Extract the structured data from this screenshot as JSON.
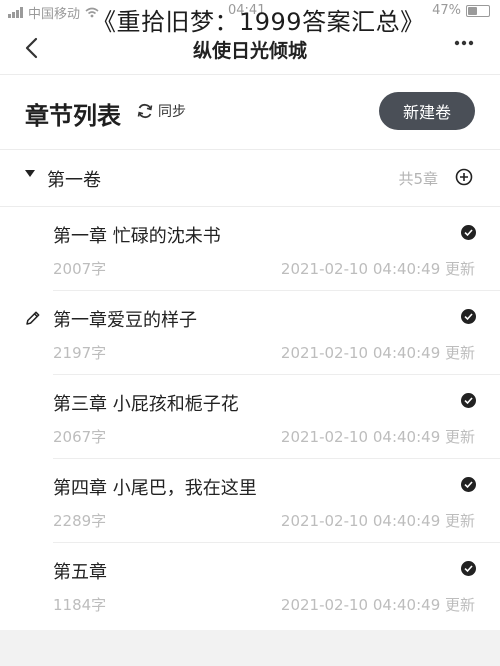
{
  "status_bar": {
    "carrier": "中国移动",
    "time": "04:41",
    "battery": "47%",
    "battery_level": 0.47
  },
  "watermark": "《重拾旧梦：1999答案汇总》",
  "nav": {
    "title": "纵使日光倾城",
    "back_icon": "chevron-left-icon",
    "more_icon": "more-dots-icon"
  },
  "header": {
    "title": "章节列表",
    "sync_label": "同步",
    "new_volume_button": "新建卷"
  },
  "volume": {
    "name": "第一卷",
    "count": "共5章",
    "add_icon": "add-circle-icon"
  },
  "chapters": [
    {
      "title": "第一章  忙碌的沈未书",
      "words": "2007字",
      "updated": "2021-02-10 04:40:49 更新"
    },
    {
      "title": "第一章爱豆的样子",
      "words": "2197字",
      "updated": "2021-02-10 04:40:49 更新"
    },
    {
      "title": "第三章 小屁孩和栀子花",
      "words": "2067字",
      "updated": "2021-02-10 04:40:49 更新"
    },
    {
      "title": "第四章 小尾巴，我在这里",
      "words": "2289字",
      "updated": "2021-02-10 04:40:49 更新"
    },
    {
      "title": "第五章",
      "words": "1184字",
      "updated": "2021-02-10 04:40:49 更新"
    }
  ],
  "colors": {
    "button_bg": "#4a4f57",
    "muted_text": "#bdbdbd",
    "check": "#222222"
  }
}
